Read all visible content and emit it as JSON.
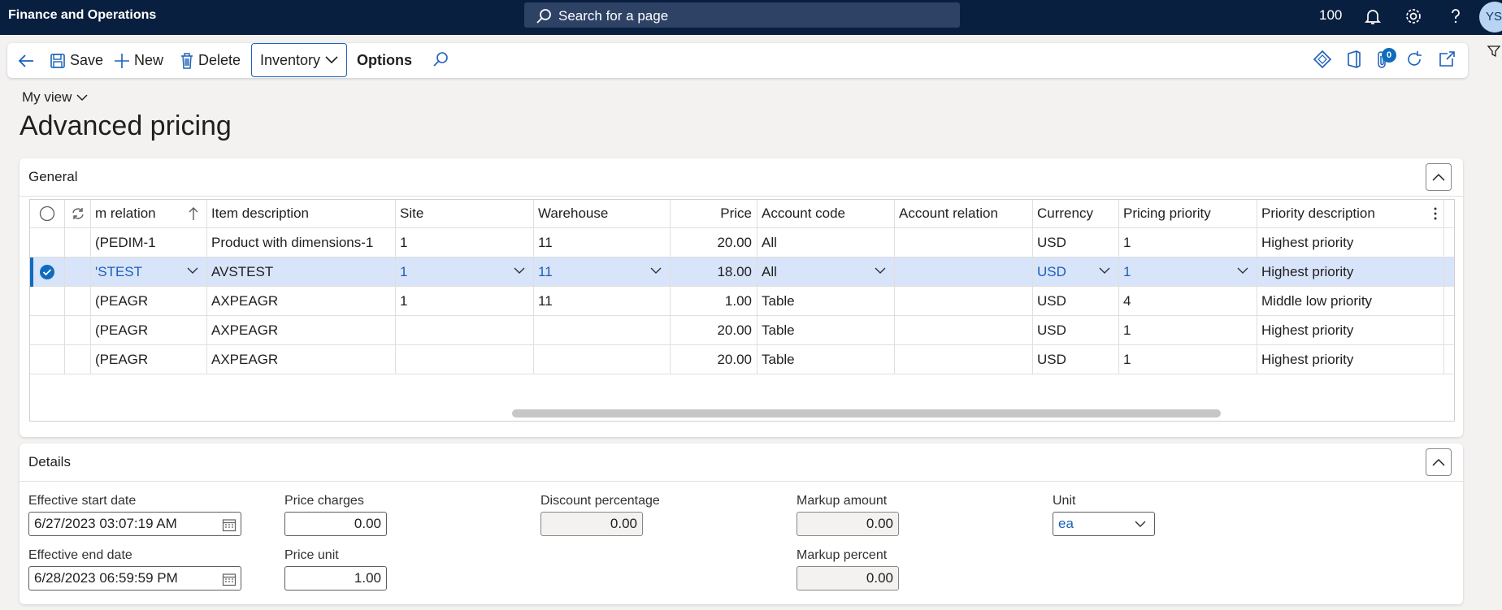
{
  "app": {
    "title": "Finance and Operations",
    "search_placeholder": "Search for a page",
    "zoom": "100",
    "avatar_initials": "YS"
  },
  "actions": {
    "save": "Save",
    "new": "New",
    "delete": "Delete",
    "inventory": "Inventory",
    "options": "Options",
    "attachments_count": "0"
  },
  "header": {
    "view": "My view",
    "title": "Advanced pricing"
  },
  "general": {
    "title": "General",
    "columns": {
      "item_relation": "m relation",
      "item_description": "Item description",
      "site": "Site",
      "warehouse": "Warehouse",
      "price": "Price",
      "account_code": "Account code",
      "account_relation": "Account relation",
      "currency": "Currency",
      "pricing_priority": "Pricing priority",
      "priority_description": "Priority description"
    },
    "rows": [
      {
        "item_relation": "(PEDIM-1",
        "item_description": "Product with dimensions-1",
        "site": "1",
        "warehouse": "11",
        "price": "20.00",
        "account_code": "All",
        "account_relation": "",
        "currency": "USD",
        "pricing_priority": "1",
        "priority_description": "Highest priority"
      },
      {
        "item_relation": "'STEST",
        "item_description": "AVSTEST",
        "site": "1",
        "warehouse": "11",
        "price": "18.00",
        "account_code": "All",
        "account_relation": "",
        "currency": "USD",
        "pricing_priority": "1",
        "priority_description": "Highest priority"
      },
      {
        "item_relation": "(PEAGR",
        "item_description": "AXPEAGR",
        "site": "1",
        "warehouse": "11",
        "price": "1.00",
        "account_code": "Table",
        "account_relation": "",
        "currency": "USD",
        "pricing_priority": "4",
        "priority_description": "Middle low priority"
      },
      {
        "item_relation": "(PEAGR",
        "item_description": "AXPEAGR",
        "site": "",
        "warehouse": "",
        "price": "20.00",
        "account_code": "Table",
        "account_relation": "",
        "currency": "USD",
        "pricing_priority": "1",
        "priority_description": "Highest priority"
      },
      {
        "item_relation": "(PEAGR",
        "item_description": "AXPEAGR",
        "site": "",
        "warehouse": "",
        "price": "20.00",
        "account_code": "Table",
        "account_relation": "",
        "currency": "USD",
        "pricing_priority": "1",
        "priority_description": "Highest priority"
      }
    ]
  },
  "details": {
    "title": "Details",
    "effective_start_label": "Effective start date",
    "effective_start_value": "6/27/2023 03:07:19 AM",
    "effective_end_label": "Effective end date",
    "effective_end_value": "6/28/2023 06:59:59 PM",
    "price_charges_label": "Price charges",
    "price_charges_value": "0.00",
    "price_unit_label": "Price unit",
    "price_unit_value": "1.00",
    "discount_pct_label": "Discount percentage",
    "discount_pct_value": "0.00",
    "markup_amount_label": "Markup amount",
    "markup_amount_value": "0.00",
    "markup_pct_label": "Markup percent",
    "markup_pct_value": "0.00",
    "unit_label": "Unit",
    "unit_value": "ea"
  }
}
